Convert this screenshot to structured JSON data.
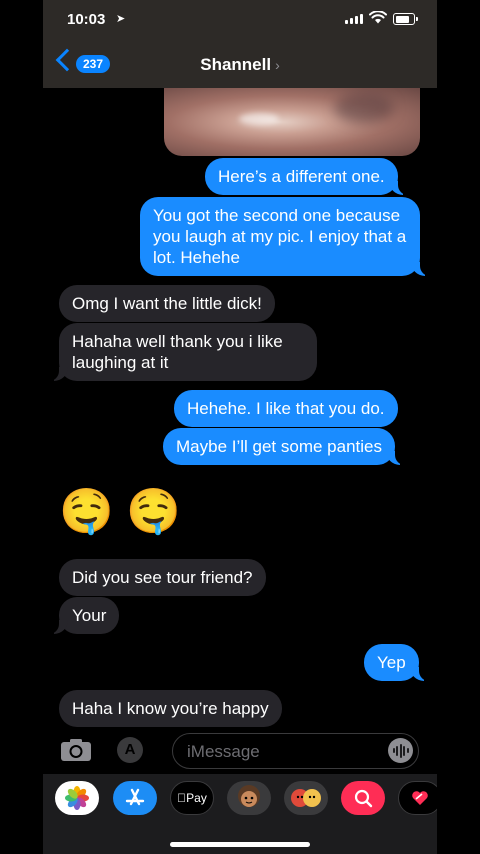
{
  "status_bar": {
    "time": "10:03"
  },
  "header": {
    "back_count": "237",
    "contact_name": "Shannell"
  },
  "messages": [
    {
      "text": "Here’s a different one.",
      "direction": "outgoing"
    },
    {
      "text": "You got the second one because you laugh at my pic. I enjoy that a lot. Hehehe",
      "direction": "outgoing"
    },
    {
      "text": "Omg I want the little dick!",
      "direction": "incoming"
    },
    {
      "text": "Hahaha well thank you i like laughing at it",
      "direction": "incoming"
    },
    {
      "text": "Hehehe. I like that you do.",
      "direction": "outgoing"
    },
    {
      "text": "Maybe I’ll get some panties",
      "direction": "outgoing"
    },
    {
      "text": "🤤 🤤",
      "direction": "incoming"
    },
    {
      "text": "Did you see tour friend?",
      "direction": "incoming"
    },
    {
      "text": "Your",
      "direction": "incoming"
    },
    {
      "text": "Yep",
      "direction": "outgoing"
    },
    {
      "text": "Haha I know you’re happy",
      "direction": "incoming"
    }
  ],
  "input": {
    "placeholder": "iMessage"
  },
  "app_drawer": {
    "apple_pay_label": "Pay",
    "apps": [
      "photos-icon",
      "app-store-icon",
      "apple-pay-icon",
      "memoji-icon",
      "memoji-stickers-icon",
      "image-search-icon",
      "digital-touch-icon"
    ]
  },
  "colors": {
    "outgoing_bubble": "#1a8cff",
    "incoming_bubble": "#26252a",
    "header_bg": "#2d2a27",
    "accent": "#0a84ff"
  }
}
